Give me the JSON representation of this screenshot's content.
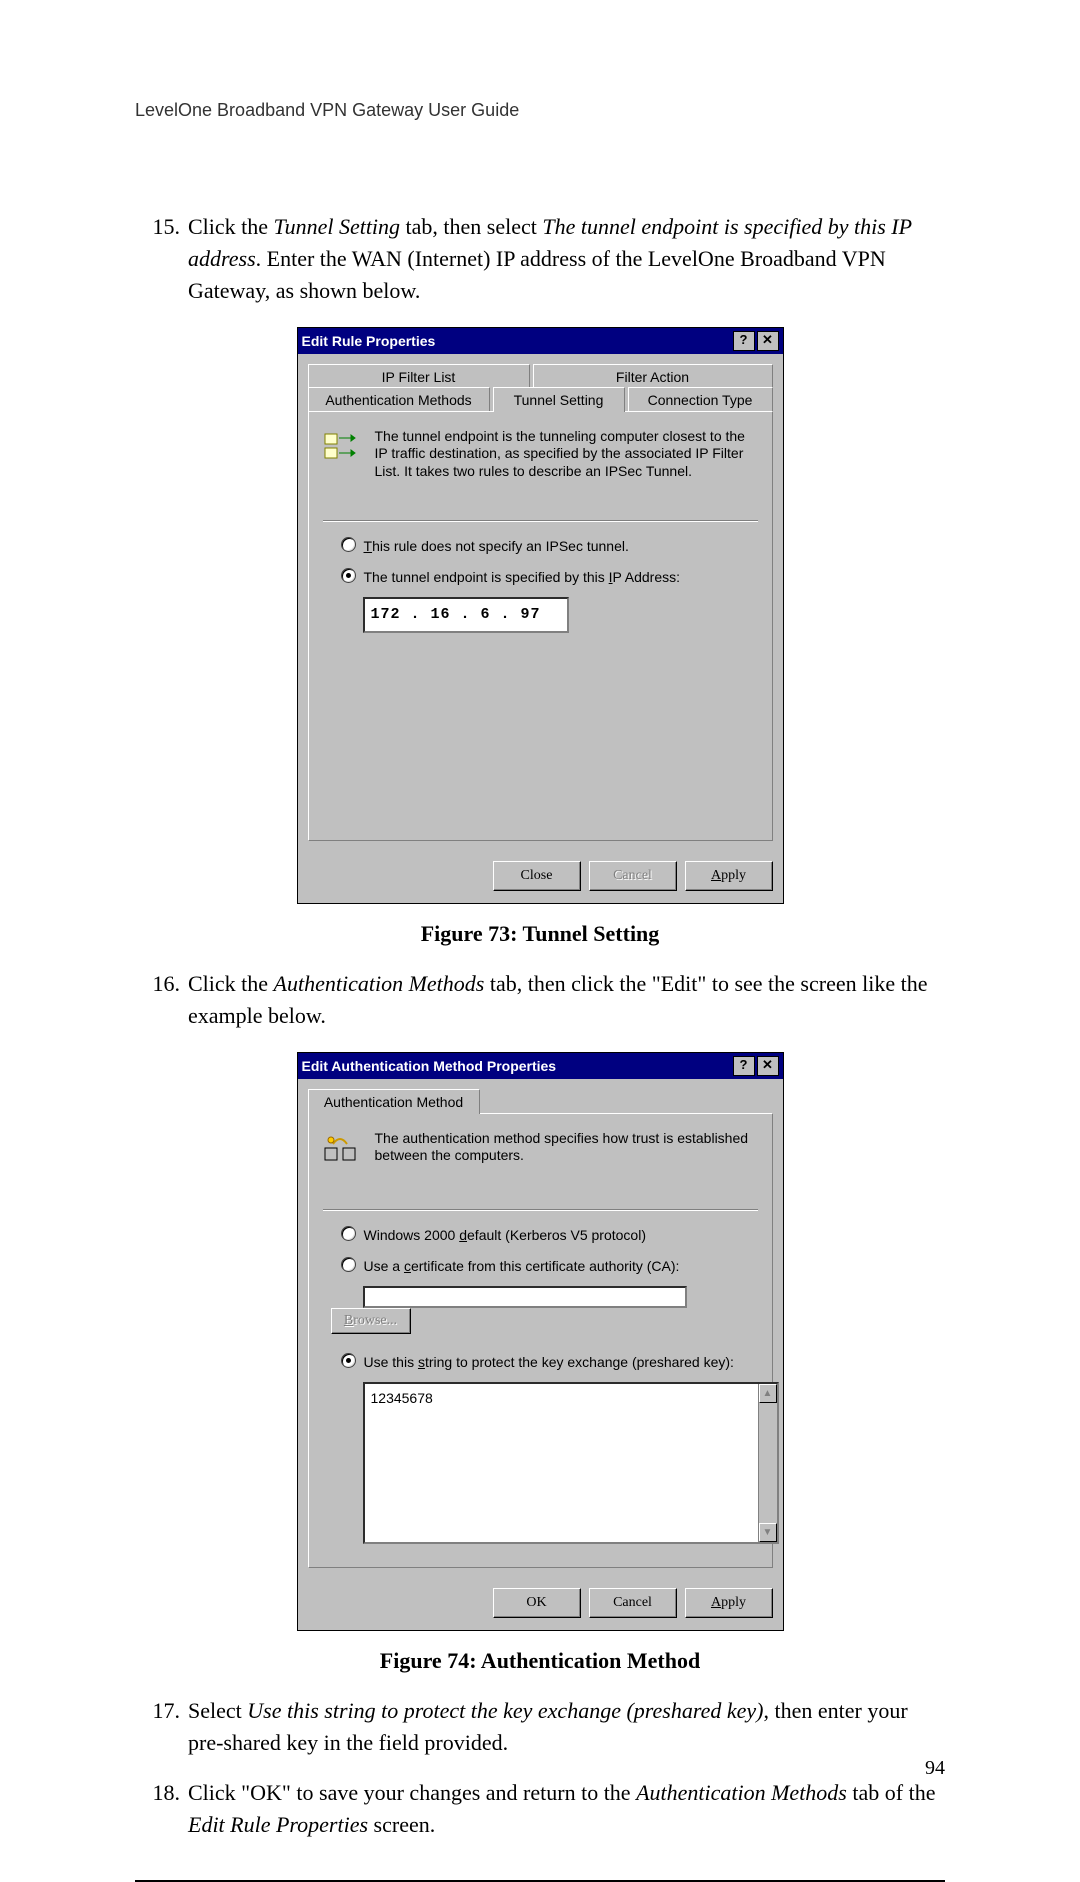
{
  "header": "LevelOne Broadband VPN Gateway User Guide",
  "pageNumber": "94",
  "steps": {
    "s15": {
      "num": "15.",
      "pre": "Click the ",
      "em1": "Tunnel Setting",
      "mid1": " tab, then select ",
      "em2": "The tunnel endpoint is specified by this IP address",
      "post": ". Enter the WAN (Internet) IP address of the LevelOne Broadband VPN Gateway, as shown below."
    },
    "s16": {
      "num": "16.",
      "pre": "Click the ",
      "em1": "Authentication Methods",
      "post": " tab, then click the \"Edit\" to see the screen like the example below."
    },
    "s17": {
      "num": "17.",
      "pre": "Select ",
      "em1": "Use this string to protect the key exchange (preshared key)",
      "post": ", then enter your pre-shared key in the field provided."
    },
    "s18": {
      "num": "18.",
      "pre": "Click \"OK\" to save your changes and return to the ",
      "em1": "Authentication Methods",
      "mid": " tab of the ",
      "em2": "Edit Rule Properties",
      "post": " screen."
    }
  },
  "fig73": {
    "caption": "Figure 73: Tunnel Setting",
    "title": "Edit Rule Properties",
    "tabs": {
      "ipfilter": "IP Filter List",
      "filteraction": "Filter Action",
      "auth": "Authentication Methods",
      "tunnel": "Tunnel Setting",
      "conn": "Connection Type"
    },
    "info": "The tunnel endpoint is the tunneling computer closest to the IP traffic destination, as specified by the associated IP Filter List. It takes two rules to describe an IPSec Tunnel.",
    "opt1_pre": "T",
    "opt1_post": "his rule does not specify an IPSec tunnel.",
    "opt2_pre": "The tunnel endpoint is specified by this ",
    "opt2_u": "I",
    "opt2_post": "P Address:",
    "ip": "172 . 16 .  6  . 97",
    "close": "Close",
    "cancel": "Cancel",
    "apply_pre": "A",
    "apply_post": "pply"
  },
  "fig74": {
    "caption": "Figure 74: Authentication Method",
    "title": "Edit Authentication Method Properties",
    "tab": "Authentication Method",
    "info": "The authentication method specifies how trust is established between the computers.",
    "opt1_pre": "Windows 2000 ",
    "opt1_u": "d",
    "opt1_post": "efault (Kerberos V5 protocol)",
    "opt2_pre": "Use a ",
    "opt2_u": "c",
    "opt2_post": "ertificate from this certificate authority (CA):",
    "browse_u": "B",
    "browse_post": "rowse...",
    "opt3_pre": "Use this ",
    "opt3_u": "s",
    "opt3_post": "tring to protect the key exchange (preshared key):",
    "psk": "12345678",
    "ok": "OK",
    "cancel": "Cancel",
    "apply_pre": "A",
    "apply_post": "pply"
  }
}
